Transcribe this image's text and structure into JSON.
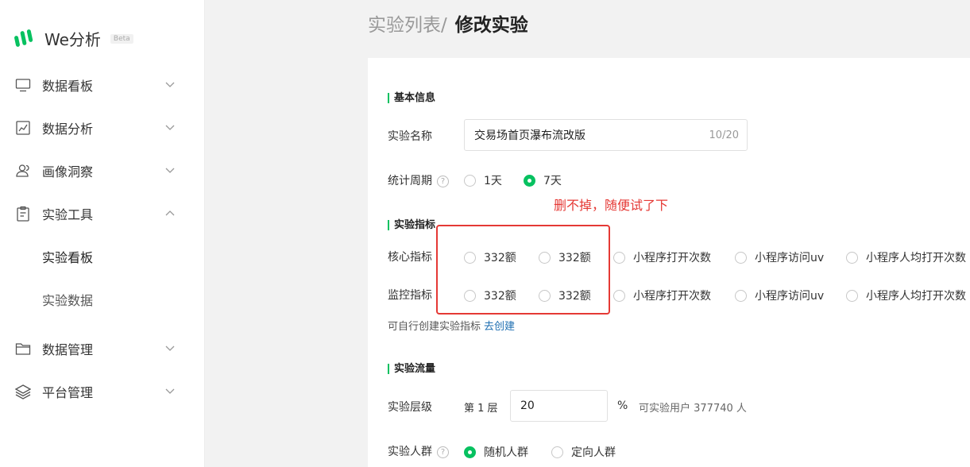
{
  "app": {
    "name": "We分析",
    "badge": "Beta"
  },
  "sidebar": {
    "items": [
      {
        "label": "数据看板",
        "icon": "monitor-icon"
      },
      {
        "label": "数据分析",
        "icon": "line-chart-icon"
      },
      {
        "label": "画像洞察",
        "icon": "users-icon"
      },
      {
        "label": "实验工具",
        "icon": "clipboard-icon"
      },
      {
        "label": "数据管理",
        "icon": "folder-icon"
      },
      {
        "label": "平台管理",
        "icon": "layers-icon"
      }
    ],
    "sub_items": [
      {
        "label": "实验看板"
      },
      {
        "label": "实验数据"
      }
    ]
  },
  "breadcrumb": {
    "parent": "实验列表",
    "separator": "/",
    "current": "修改实验"
  },
  "basic": {
    "title": "基本信息",
    "name_label": "实验名称",
    "name_value": "交易场首页瀑布流改版",
    "name_counter": "10/20",
    "period_label": "统计周期",
    "period_help": "?",
    "period_options": [
      "1天",
      "7天"
    ],
    "period_selected": "7天"
  },
  "metrics": {
    "title": "实验指标",
    "core_label": "核心指标",
    "monitor_label": "监控指标",
    "options": [
      "332额",
      "332额",
      "小程序打开次数",
      "小程序访问uv",
      "小程序人均打开次数"
    ],
    "hint": "可自行创建实验指标",
    "hint_link": "去创建"
  },
  "annotation": {
    "text": "删不掉，随便试了下"
  },
  "traffic": {
    "title": "实验流量",
    "level_label": "实验层级",
    "level_value": "第 1 层",
    "percent_value": "20",
    "percent_unit": "%",
    "available_users": "可实验用户 377740 人",
    "audience_label": "实验人群",
    "audience_help": "?",
    "audience_options": [
      "随机人群",
      "定向人群"
    ],
    "audience_selected": "随机人群"
  },
  "colors": {
    "accent": "#07c160",
    "annotation": "#e53935",
    "link": "#1f6fb2"
  }
}
